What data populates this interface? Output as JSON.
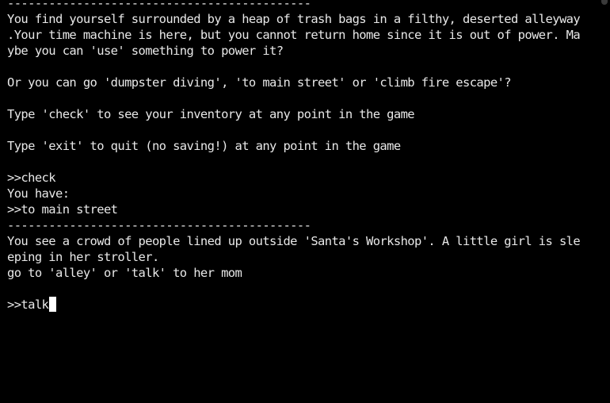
{
  "terminal": {
    "colors": {
      "background": "#000000",
      "text": "#e8e8e8",
      "cursor": "#ffffff"
    },
    "lines": [
      "--------------------------------------------",
      "You find yourself surrounded by a heap of trash bags in a filthy, deserted alleyway",
      ".Your time machine is here, but you cannot return home since it is out of power. Ma",
      "ybe you can 'use' something to power it?",
      "",
      "Or you can go 'dumpster diving', 'to main street' or 'climb fire escape'?",
      "",
      "Type 'check' to see your inventory at any point in the game",
      "",
      "Type 'exit' to quit (no saving!) at any point in the game",
      "",
      ">>check",
      "You have:",
      ">>to main street",
      "--------------------------------------------",
      "You see a crowd of people lined up outside 'Santa's Workshop'. A little girl is sle",
      "eping in her stroller.",
      "go to 'alley' or 'talk' to her mom",
      "",
      ">>talk"
    ]
  }
}
